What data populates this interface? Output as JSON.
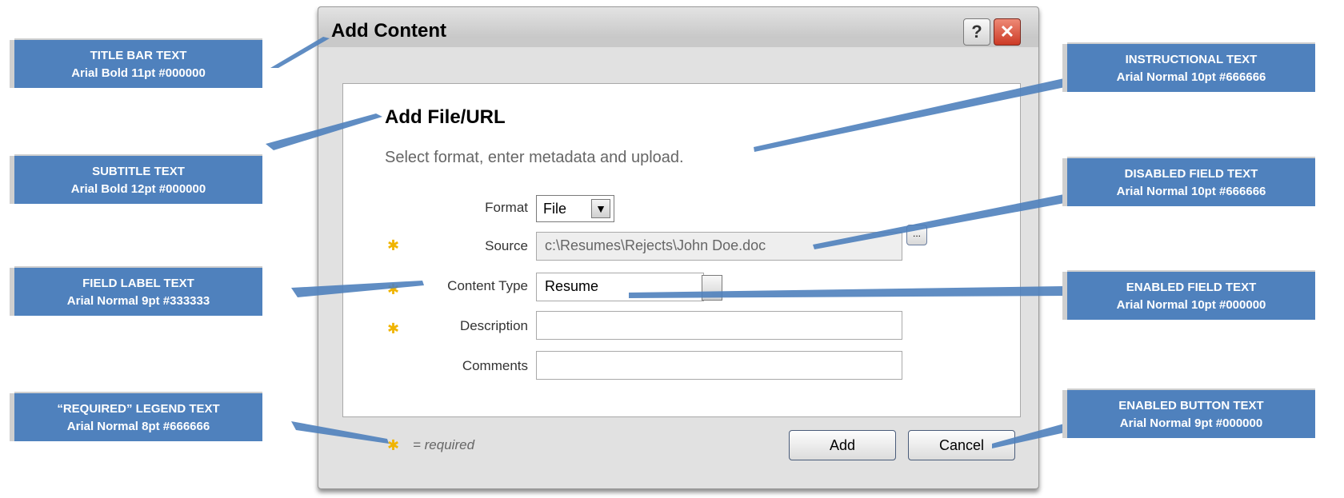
{
  "dialog": {
    "title": "Add Content",
    "help_label": "?",
    "close_label": "✕",
    "subtitle": "Add File/URL",
    "instruction": "Select format, enter metadata and upload.",
    "fields": {
      "format": {
        "label": "Format",
        "value": "File"
      },
      "source": {
        "label": "Source",
        "value": "c:\\Resumes\\Rejects\\John Doe.doc"
      },
      "content_type": {
        "label": "Content Type",
        "value": "Resume"
      },
      "description": {
        "label": "Description",
        "value": ""
      },
      "comments": {
        "label": "Comments",
        "value": ""
      }
    },
    "browse_label": "...",
    "legend": "= required",
    "buttons": {
      "add": "Add",
      "cancel": "Cancel"
    }
  },
  "callouts": {
    "title_bar": {
      "line1": "TITLE BAR TEXT",
      "line2": "Arial Bold 11pt #000000"
    },
    "subtitle": {
      "line1": "SUBTITLE TEXT",
      "line2": "Arial Bold 12pt #000000"
    },
    "field_label": {
      "line1": "FIELD LABEL TEXT",
      "line2": "Arial Normal 9pt #333333"
    },
    "required_legend": {
      "line1": "“REQUIRED” LEGEND TEXT",
      "line2": "Arial Normal 8pt #666666"
    },
    "instructional": {
      "line1": "INSTRUCTIONAL TEXT",
      "line2": "Arial Normal 10pt #666666"
    },
    "disabled_field": {
      "line1": "DISABLED FIELD TEXT",
      "line2": "Arial Normal 10pt #666666"
    },
    "enabled_field": {
      "line1": "ENABLED FIELD TEXT",
      "line2": "Arial Normal 10pt #000000"
    },
    "enabled_button": {
      "line1": "ENABLED BUTTON TEXT",
      "line2": "Arial Normal 9pt #000000"
    }
  },
  "colors": {
    "callout_bg": "#4f81bd",
    "required_star": "#f0b400",
    "close_button": "#cc3a26"
  }
}
